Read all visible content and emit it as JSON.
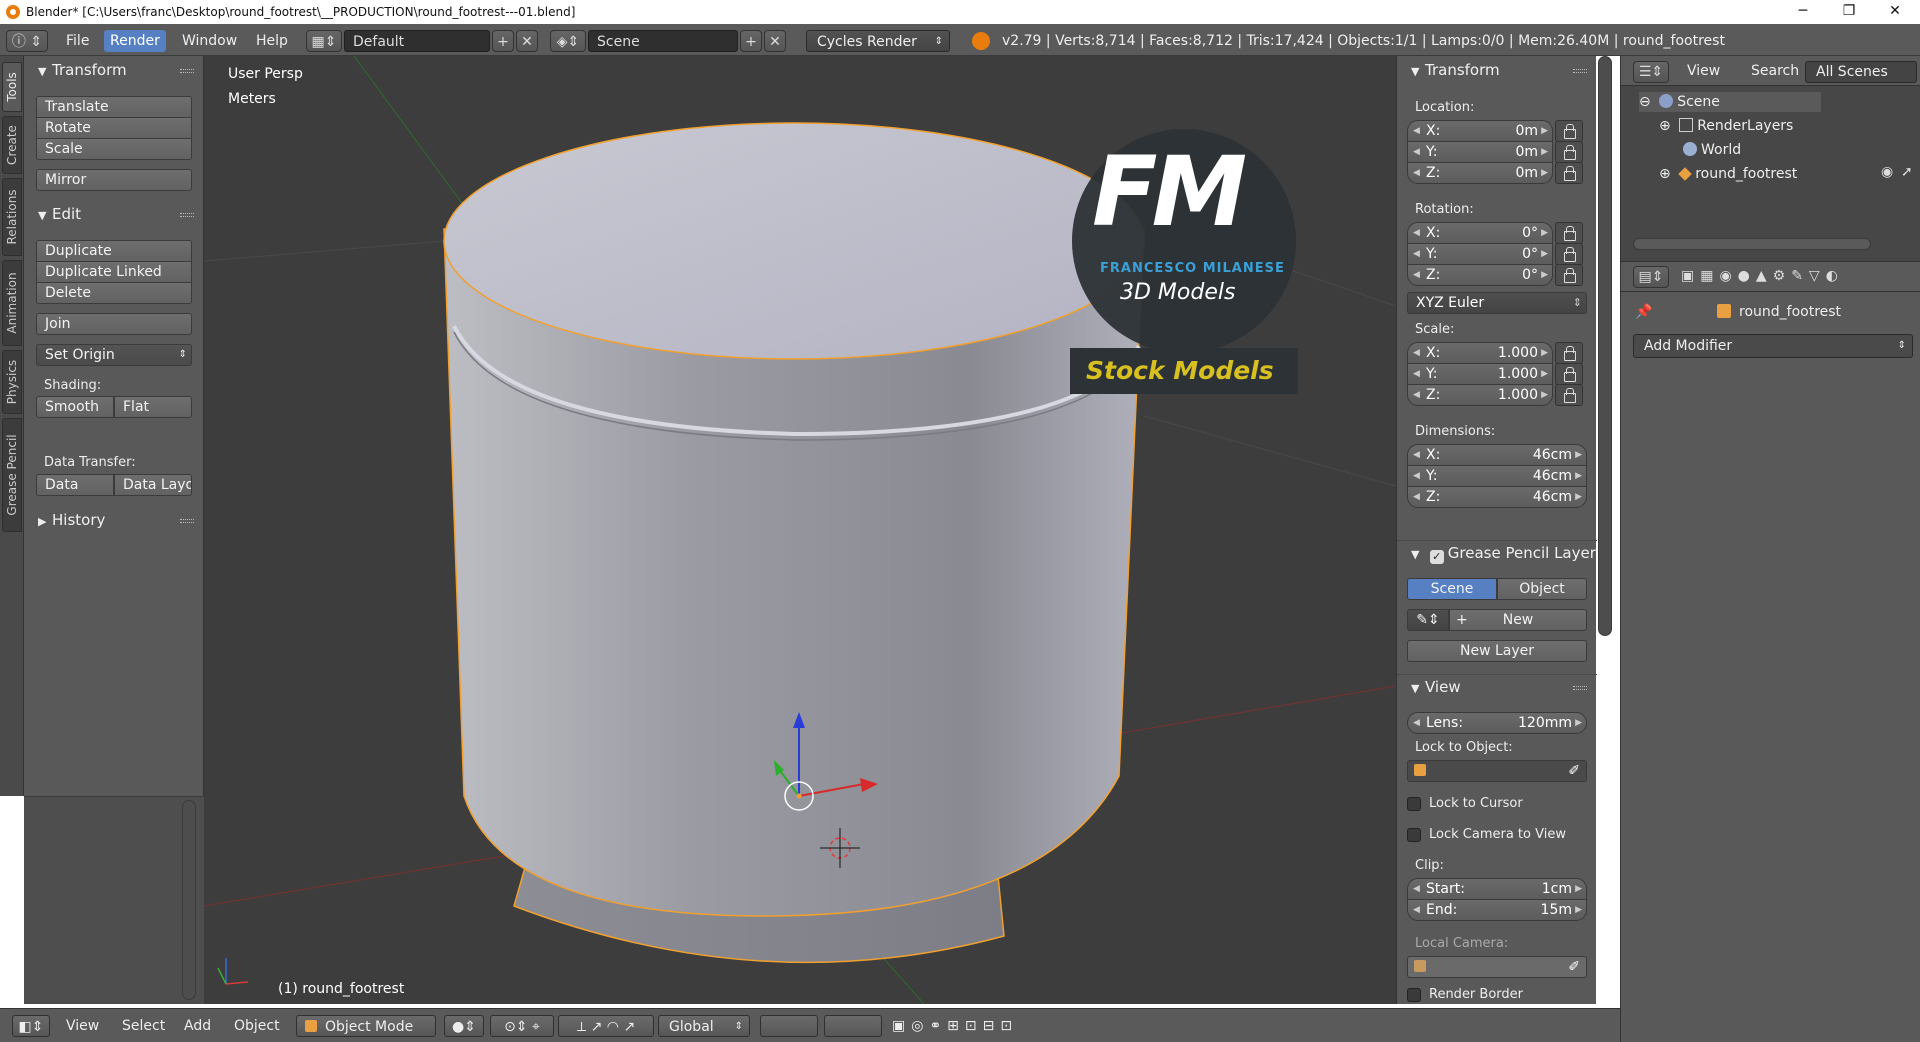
{
  "window": {
    "title": "Blender* [C:\\Users\\franc\\Desktop\\round_footrest\\__PRODUCTION\\round_footrest---01.blend]",
    "minimize": "─",
    "restore": "❐",
    "close": "✕"
  },
  "info_header": {
    "menus": [
      "File",
      "Render",
      "Window",
      "Help"
    ],
    "active_menu": "Render",
    "layout": "Default",
    "scene": "Scene",
    "engine": "Cycles Render",
    "stats": "v2.79 | Verts:8,714 | Faces:8,712 | Tris:17,424 | Objects:1/1 | Lamps:0/0 | Mem:26.40M | round_footrest"
  },
  "tool_tabs": [
    "Tools",
    "Create",
    "Relations",
    "Animation",
    "Physics",
    "Grease Pencil"
  ],
  "tool_shelf": {
    "transform_title": "Transform",
    "translate": "Translate",
    "rotate": "Rotate",
    "scale": "Scale",
    "mirror": "Mirror",
    "edit_title": "Edit",
    "duplicate": "Duplicate",
    "duplicate_linked": "Duplicate Linked",
    "delete": "Delete",
    "join": "Join",
    "set_origin": "Set Origin",
    "shading_label": "Shading:",
    "smooth": "Smooth",
    "flat": "Flat",
    "data_transfer_label": "Data Transfer:",
    "data": "Data",
    "data_layout": "Data Layo",
    "history_title": "History"
  },
  "viewport": {
    "view_name": "User Persp",
    "units": "Meters",
    "object_label": "(1) round_footrest",
    "logo_letters": "FM",
    "logo_name": "FRANCESCO MILANESE",
    "logo_sub": "3D Models",
    "logo_banner": "Stock Models"
  },
  "bottom_header": {
    "menus": [
      "View",
      "Select",
      "Add",
      "Object"
    ],
    "mode": "Object Mode",
    "orientation": "Global"
  },
  "npanel": {
    "transform_title": "Transform",
    "location_label": "Location:",
    "location": [
      {
        "axis": "X:",
        "value": "0m"
      },
      {
        "axis": "Y:",
        "value": "0m"
      },
      {
        "axis": "Z:",
        "value": "0m"
      }
    ],
    "rotation_label": "Rotation:",
    "rotation": [
      {
        "axis": "X:",
        "value": "0°"
      },
      {
        "axis": "Y:",
        "value": "0°"
      },
      {
        "axis": "Z:",
        "value": "0°"
      }
    ],
    "rotation_mode": "XYZ Euler",
    "scale_label": "Scale:",
    "scale": [
      {
        "axis": "X:",
        "value": "1.000"
      },
      {
        "axis": "Y:",
        "value": "1.000"
      },
      {
        "axis": "Z:",
        "value": "1.000"
      }
    ],
    "dimensions_label": "Dimensions:",
    "dimensions": [
      {
        "axis": "X:",
        "value": "46cm"
      },
      {
        "axis": "Y:",
        "value": "46cm"
      },
      {
        "axis": "Z:",
        "value": "46cm"
      }
    ],
    "gp_title": "Grease Pencil Layer",
    "gp_scene": "Scene",
    "gp_object": "Object",
    "gp_new": "New",
    "gp_new_layer": "New Layer",
    "view_title": "View",
    "lens_label": "Lens:",
    "lens_value": "120mm",
    "lock_object_label": "Lock to Object:",
    "lock_cursor": "Lock to Cursor",
    "lock_camera": "Lock Camera to View",
    "clip_label": "Clip:",
    "clip_start_label": "Start:",
    "clip_start": "1cm",
    "clip_end_label": "End:",
    "clip_end": "15m",
    "local_camera_label": "Local Camera:",
    "render_border": "Render Border"
  },
  "outliner": {
    "view": "View",
    "search": "Search",
    "filter": "All Scenes",
    "items": [
      "Scene",
      "RenderLayers",
      "World",
      "round_footrest"
    ]
  },
  "properties": {
    "object_name": "round_footrest",
    "add_modifier": "Add Modifier"
  },
  "colors": {
    "accent": "#5680c2",
    "selection_outline": "#f0a030",
    "viewport_bg": "#3d3d3d",
    "logo_blue": "#3aa0d8",
    "logo_yellow": "#d8c020"
  }
}
